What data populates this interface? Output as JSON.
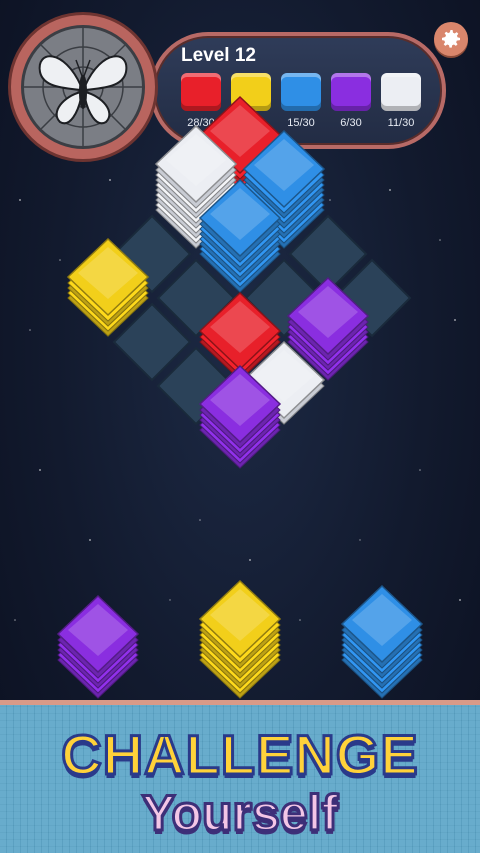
{
  "hud": {
    "level_label": "Level 12",
    "goals": [
      {
        "color_name": "red",
        "color": "#e8202a",
        "count": "28/30"
      },
      {
        "color_name": "yellow",
        "color": "#f2cf1a",
        "count": "10/30"
      },
      {
        "color_name": "blue",
        "color": "#2f8fe6",
        "count": "15/30"
      },
      {
        "color_name": "purple",
        "color": "#8a2ee0",
        "count": "6/30"
      },
      {
        "color_name": "white",
        "color": "#eceef3",
        "count": "11/30"
      }
    ],
    "badge_icon": "butterfly-icon",
    "settings_icon": "gear-icon"
  },
  "board": {
    "cells": 16,
    "stacks": [
      {
        "color": "#e8202a",
        "layers": 6
      },
      {
        "color": "#2f8fe6",
        "layers": 8
      },
      {
        "color": "#eceef3",
        "layers": 9
      },
      {
        "color": "#f2cf1a",
        "layers": 4
      },
      {
        "color": "#2f8fe6",
        "layers": 7
      },
      {
        "color": "#8a2ee0",
        "layers": 5
      },
      {
        "color": "#e8202a",
        "layers": 2
      },
      {
        "color": "#eceef3",
        "layers": 1
      },
      {
        "color": "#8a2ee0",
        "layers": 5
      }
    ]
  },
  "tray": [
    {
      "color": "#8a2ee0",
      "layers": 5
    },
    {
      "color": "#f2cf1a",
      "layers": 8
    },
    {
      "color": "#2f8fe6",
      "layers": 7
    }
  ],
  "banner": {
    "line1": "CHALLENGE",
    "line2": "Yourself"
  }
}
